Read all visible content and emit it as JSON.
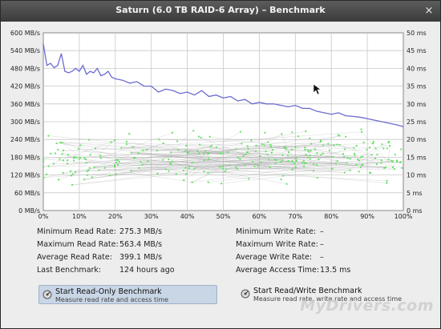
{
  "window": {
    "title": "Saturn (6.0 TB RAID-6 Array) – Benchmark",
    "close_glyph": "×"
  },
  "chart_data": {
    "type": "line",
    "x_ticks": [
      "0%",
      "10%",
      "20%",
      "30%",
      "40%",
      "50%",
      "60%",
      "70%",
      "80%",
      "90%",
      "100%"
    ],
    "y_left_ticks": [
      "0 MB/s",
      "60 MB/s",
      "120 MB/s",
      "180 MB/s",
      "240 MB/s",
      "300 MB/s",
      "360 MB/s",
      "420 MB/s",
      "480 MB/s",
      "540 MB/s",
      "600 MB/s"
    ],
    "y_right_ticks": [
      "0 ms",
      "5 ms",
      "10 ms",
      "15 ms",
      "20 ms",
      "25 ms",
      "30 ms",
      "35 ms",
      "40 ms",
      "45 ms",
      "50 ms"
    ],
    "ylim_left": [
      0,
      600
    ],
    "ylim_right": [
      0,
      50
    ],
    "xlim": [
      0,
      100
    ],
    "grid": true,
    "read_rate": {
      "color": "#6b6bd0",
      "x": [
        0,
        1,
        2,
        3,
        4,
        5,
        6,
        7,
        8,
        9,
        10,
        11,
        12,
        13,
        14,
        15,
        16,
        17,
        18,
        19,
        20,
        22,
        24,
        26,
        28,
        30,
        32,
        34,
        36,
        38,
        40,
        42,
        44,
        46,
        48,
        50,
        52,
        54,
        56,
        58,
        60,
        62,
        64,
        66,
        68,
        70,
        72,
        74,
        76,
        78,
        80,
        82,
        84,
        86,
        88,
        90,
        92,
        94,
        96,
        98,
        100
      ],
      "y": [
        563,
        490,
        497,
        482,
        490,
        530,
        470,
        465,
        470,
        480,
        470,
        490,
        460,
        470,
        465,
        480,
        455,
        460,
        470,
        450,
        445,
        440,
        430,
        435,
        420,
        420,
        400,
        410,
        405,
        395,
        400,
        390,
        405,
        385,
        390,
        380,
        385,
        370,
        375,
        360,
        365,
        360,
        360,
        355,
        350,
        355,
        345,
        345,
        335,
        330,
        325,
        330,
        320,
        318,
        315,
        310,
        305,
        300,
        295,
        290,
        283
      ]
    },
    "access_time": {
      "color": "#66e066",
      "min_ms": 6,
      "max_ms": 24,
      "mean_ms": 13.5
    }
  },
  "stats": {
    "min_read_label": "Minimum Read Rate:",
    "min_read_value": "275.3 MB/s",
    "max_read_label": "Maximum Read Rate:",
    "max_read_value": "563.4 MB/s",
    "avg_read_label": "Average Read Rate:",
    "avg_read_value": "399.1 MB/s",
    "last_bench_label": "Last Benchmark:",
    "last_bench_value": "124 hours ago",
    "min_write_label": "Minimum Write Rate:",
    "min_write_value": "–",
    "max_write_label": "Maximum Write Rate:",
    "max_write_value": "–",
    "avg_write_label": "Average Write Rate:",
    "avg_write_value": "–",
    "avg_access_label": "Average Access Time:",
    "avg_access_value": "13.5 ms"
  },
  "buttons": {
    "read_only_title": "Start Read-Only Benchmark",
    "read_only_desc": "Measure read rate and access time",
    "read_write_title": "Start Read/Write Benchmark",
    "read_write_desc": "Measure read rate, write rate and access time"
  },
  "watermark": "MyDrivers.com"
}
